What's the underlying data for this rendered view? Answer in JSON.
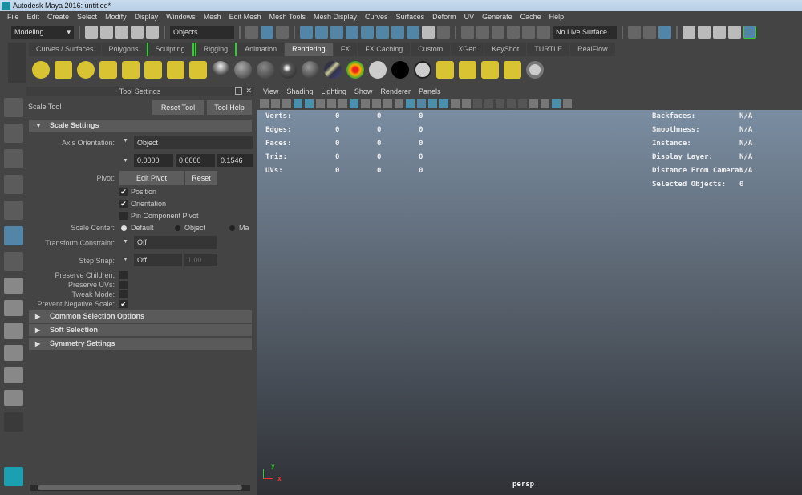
{
  "window": {
    "title": "Autodesk Maya 2016: untitled*"
  },
  "menu": [
    "File",
    "Edit",
    "Create",
    "Select",
    "Modify",
    "Display",
    "Windows",
    "Mesh",
    "Edit Mesh",
    "Mesh Tools",
    "Mesh Display",
    "Curves",
    "Surfaces",
    "Deform",
    "UV",
    "Generate",
    "Cache",
    "Help"
  ],
  "status": {
    "mode": "Modeling",
    "selection_mask": "Objects",
    "live_surface": "No Live Surface"
  },
  "shelf_tabs": [
    {
      "label": "Curves / Surfaces"
    },
    {
      "label": "Polygons"
    },
    {
      "label": "Sculpting"
    },
    {
      "label": "Rigging"
    },
    {
      "label": "Animation"
    },
    {
      "label": "Rendering",
      "active": true
    },
    {
      "label": "FX"
    },
    {
      "label": "FX Caching"
    },
    {
      "label": "Custom"
    },
    {
      "label": "XGen"
    },
    {
      "label": "KeyShot"
    },
    {
      "label": "TURTLE"
    },
    {
      "label": "RealFlow"
    }
  ],
  "tool_settings": {
    "panel_title": "Tool Settings",
    "tool_name": "Scale Tool",
    "reset_tool": "Reset Tool",
    "tool_help": "Tool Help",
    "scale_settings": "Scale Settings",
    "axis_orientation_label": "Axis Orientation:",
    "axis_orientation": "Object",
    "axis_values": [
      "0.0000",
      "0.0000",
      "0.1546"
    ],
    "pivot_label": "Pivot:",
    "edit_pivot": "Edit Pivot",
    "reset": "Reset",
    "position": "Position",
    "position_checked": true,
    "orientation": "Orientation",
    "orientation_checked": true,
    "pin_component_pivot": "Pin Component Pivot",
    "pin_checked": false,
    "scale_center_label": "Scale Center:",
    "scale_center_options": [
      "Default",
      "Object",
      "Ma"
    ],
    "scale_center_selected": "Default",
    "transform_constraint_label": "Transform Constraint:",
    "transform_constraint": "Off",
    "step_snap_label": "Step Snap:",
    "step_snap": "Off",
    "step_snap_value": "1.00",
    "preserve_children": "Preserve Children:",
    "preserve_uvs": "Preserve UVs:",
    "tweak_mode": "Tweak Mode:",
    "prevent_negative_scale": "Prevent Negative Scale:",
    "check_mark": "✔",
    "sections": [
      "Common Selection Options",
      "Soft Selection",
      "Symmetry Settings"
    ]
  },
  "viewport": {
    "menu": [
      "View",
      "Shading",
      "Lighting",
      "Show",
      "Renderer",
      "Panels"
    ],
    "hud_left": [
      {
        "label": "Verts:",
        "values": [
          "0",
          "0",
          "0"
        ]
      },
      {
        "label": "Edges:",
        "values": [
          "0",
          "0",
          "0"
        ]
      },
      {
        "label": "Faces:",
        "values": [
          "0",
          "0",
          "0"
        ]
      },
      {
        "label": "Tris:",
        "values": [
          "0",
          "0",
          "0"
        ]
      },
      {
        "label": "UVs:",
        "values": [
          "0",
          "0",
          "0"
        ]
      }
    ],
    "hud_right": [
      {
        "label": "Backfaces:",
        "value": "N/A"
      },
      {
        "label": "Smoothness:",
        "value": "N/A"
      },
      {
        "label": "Instance:",
        "value": "N/A"
      },
      {
        "label": "Display Layer:",
        "value": "N/A"
      },
      {
        "label": "Distance From Camera:",
        "value": "N/A"
      },
      {
        "label": "Selected Objects:",
        "value": "0"
      }
    ],
    "camera": "persp",
    "axis_y": "y",
    "axis_x": "x"
  },
  "colors": {
    "accent": "#5285a6",
    "viewport_top": "#7a8da1",
    "viewport_bottom": "#2f3136"
  }
}
